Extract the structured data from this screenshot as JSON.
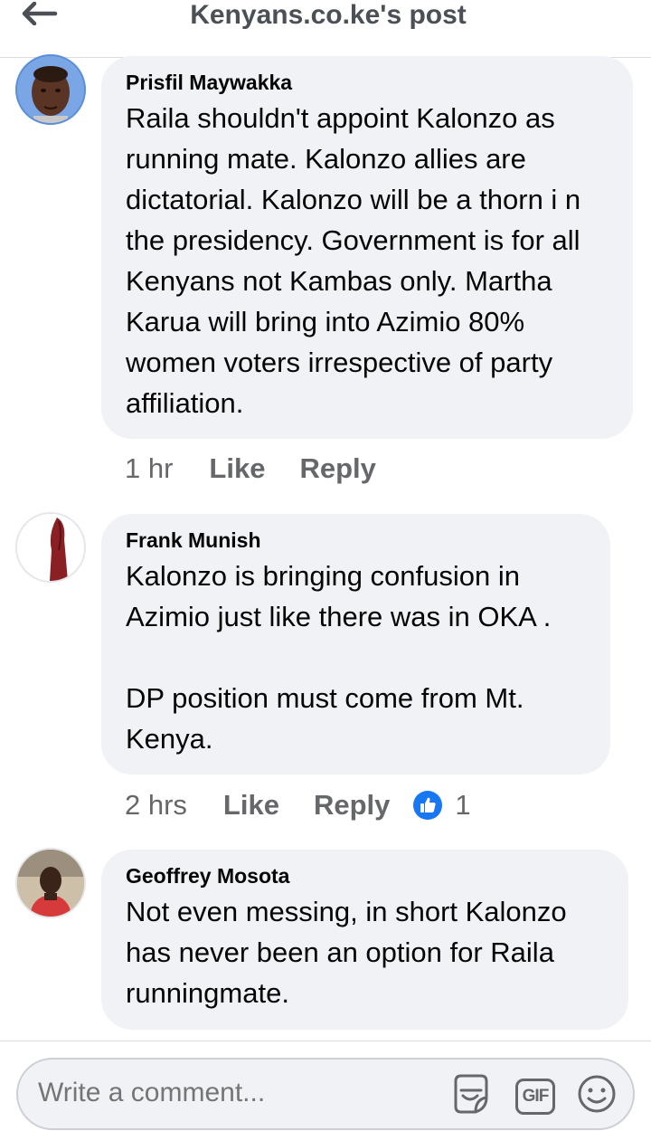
{
  "header": {
    "title": "Kenyans.co.ke's post",
    "back_icon": "back-arrow-icon"
  },
  "comments": [
    {
      "author": "Prisfil Maywakka",
      "text": "Raila shouldn't appoint Kalonzo as running mate. Kalonzo allies are dictatorial. Kalonzo will be a thorn i n the presidency. Government is for all Kenyans not Kambas only. Martha Karua will bring into Azimio 80% women voters irrespective of party affiliation.",
      "time": "1 hr",
      "like_label": "Like",
      "reply_label": "Reply"
    },
    {
      "author": "Frank Munish",
      "text": "Kalonzo is bringing confusion in Azimio just like there was in OKA .\n\nDP position must come from Mt. Kenya.",
      "time": "2 hrs",
      "like_label": "Like",
      "reply_label": "Reply",
      "reaction_count": "1",
      "reaction_icon": "thumbs-up-icon"
    },
    {
      "author": "Geoffrey Mosota",
      "text": "Not even messing, in short Kalonzo has never been an option for Raila runningmate."
    }
  ],
  "composer": {
    "placeholder": "Write a comment...",
    "sticker_icon": "sticker-icon",
    "gif_label": "GIF",
    "emoji_icon": "emoji-icon"
  },
  "colors": {
    "bubble": "#f0f2f5",
    "meta_text": "#65676b",
    "like_blue": "#1877f2"
  }
}
